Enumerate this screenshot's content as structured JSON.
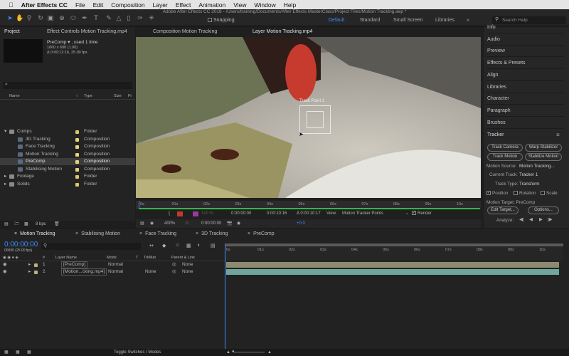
{
  "menubar": {
    "app_name": "After Effects CC",
    "items": [
      "File",
      "Edit",
      "Composition",
      "Layer",
      "Effect",
      "Animation",
      "View",
      "Window",
      "Help"
    ]
  },
  "title_bar": {
    "text": "Adobe After Effects CC 2018 - /Users/training/Documents/After Effects MasterClass/Project Files/Motion Tracking.aep *"
  },
  "toolbar": {
    "snapping_label": "Snapping",
    "workspaces": [
      "Default",
      "Standard",
      "Small Screen",
      "Libraries"
    ],
    "active_workspace": "Default",
    "search_placeholder": "Search Help"
  },
  "project_panel": {
    "tab_project": "Project",
    "tab_effect_controls": "Effect Controls Motion Tracking.mp4",
    "selected_name": "PreComp ▾ , used 1 time",
    "selected_dims": "1000 x 600 (1.00)",
    "selected_dur": "Δ 0:00:12:16, 25.00 fps",
    "search_glyph": "⌕",
    "columns": {
      "name": "Name",
      "type": "Type",
      "size": "Size",
      "fr": "Fr"
    },
    "items": [
      {
        "name": "Comps",
        "type": "Folder",
        "indent": 0,
        "kind": "folder",
        "color": "#d8c96b",
        "twirl": "▾",
        "selected": false
      },
      {
        "name": "3D Tracking",
        "type": "Composition",
        "indent": 1,
        "kind": "comp",
        "color": "#e8d27a",
        "twirl": "",
        "selected": false
      },
      {
        "name": "Face Tracking",
        "type": "Composition",
        "indent": 1,
        "kind": "comp",
        "color": "#e8d27a",
        "twirl": "",
        "selected": false
      },
      {
        "name": "Motion Tracking",
        "type": "Composition",
        "indent": 1,
        "kind": "comp",
        "color": "#e8d27a",
        "twirl": "",
        "selected": false
      },
      {
        "name": "PreComp",
        "type": "Composition",
        "indent": 1,
        "kind": "comp",
        "color": "#e8d27a",
        "twirl": "",
        "selected": true
      },
      {
        "name": "Stabilising Motion",
        "type": "Composition",
        "indent": 1,
        "kind": "comp",
        "color": "#e8d27a",
        "twirl": "",
        "selected": false
      },
      {
        "name": "Footage",
        "type": "Folder",
        "indent": 0,
        "kind": "folder",
        "color": "#d8c96b",
        "twirl": "▸",
        "selected": false
      },
      {
        "name": "Solids",
        "type": "Folder",
        "indent": 0,
        "kind": "folder",
        "color": "#d8c96b",
        "twirl": "▸",
        "selected": false
      }
    ],
    "bpc": "8 bpc"
  },
  "viewer": {
    "tab_comp": "Composition Motion Tracking",
    "tab_layer": "Layer Motion Tracking.mp4",
    "track_point_label": "Track Point 1",
    "ruler_ticks": [
      "0s",
      "01s",
      "02s",
      "03s",
      "04s",
      "05s",
      "06s",
      "07s",
      "08s",
      "09s",
      "10s"
    ],
    "current_time": "0:00:00:00",
    "in_time": "0:00:10:16",
    "duration": "Δ 0:00:10:17",
    "view_label": "View:",
    "view_value": "Motion Tracker Points",
    "render_label": "Render",
    "zoom": "400%",
    "bottom_time": "0:00:00:00",
    "exposure": "+0.0",
    "percent": "100 %"
  },
  "right_panels": {
    "items": [
      "Info",
      "Audio",
      "Preview",
      "Effects & Presets",
      "Align",
      "Libraries",
      "Character",
      "Paragraph",
      "Brushes"
    ]
  },
  "tracker": {
    "title": "Tracker",
    "track_camera": "Track Camera",
    "warp_stabilizer": "Warp Stabilizer",
    "track_motion": "Track Motion",
    "stabilize_motion": "Stabilize Motion",
    "motion_source_label": "Motion Source:",
    "motion_source_value": "Motion Tracking...",
    "current_track_label": "Current Track:",
    "current_track_value": "Tracker 1",
    "track_type_label": "Track Type:",
    "track_type_value": "Transform",
    "position_label": "Position",
    "rotation_label": "Rotation",
    "scale_label": "Scale",
    "motion_target": "Motion Target: PreComp",
    "edit_target": "Edit Target...",
    "options": "Options...",
    "analyze_label": "Analyze:"
  },
  "timeline": {
    "tabs": [
      "Motion Tracking",
      "Stabilising Motion",
      "Face Tracking",
      "3D Tracking",
      "PreComp"
    ],
    "active_tab": "Motion Tracking",
    "timecode": "0:00:00:00",
    "frame_info": "00000 (25.00 fps)",
    "columns": {
      "num": "#",
      "layer_name": "Layer Name",
      "mode": "Mode",
      "t": "T",
      "trkmat": "TrkMat",
      "parent": "Parent & Link"
    },
    "layers": [
      {
        "num": "1",
        "name": "[PreComp]",
        "mode": "Normal",
        "trkmat": "",
        "parent": "None",
        "bar": "#8e8a72"
      },
      {
        "num": "2",
        "name": "[Motion...cking.mp4]",
        "mode": "Normal",
        "trkmat": "None",
        "parent": "None",
        "bar": "#6fa79c"
      }
    ],
    "ruler": [
      "0s",
      "01s",
      "02s",
      "03s",
      "04s",
      "05s",
      "06s",
      "07s",
      "08s",
      "09s",
      "10s"
    ],
    "toggle_label": "Toggle Switches / Modes"
  }
}
